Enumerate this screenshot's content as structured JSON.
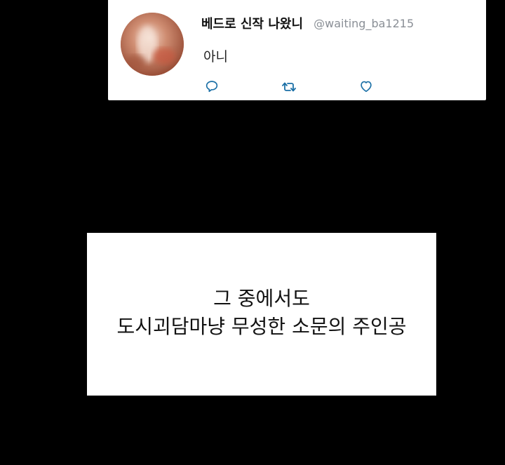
{
  "tweet": {
    "display_name": "베드로 신작 나왔니",
    "handle": "@waiting_ba1215",
    "text": "아니",
    "actions": {
      "reply_icon": "reply-icon",
      "retweet_icon": "retweet-icon",
      "like_icon": "heart-icon"
    },
    "colors": {
      "card_bg": "#ffffff",
      "name": "#111111",
      "handle": "#8a8f96",
      "icon": "#1a6fa6"
    }
  },
  "caption": {
    "lines": [
      "그 중에서도",
      "도시괴담마냥 무성한 소문의 주인공"
    ]
  },
  "colors": {
    "page_bg": "#000000"
  }
}
